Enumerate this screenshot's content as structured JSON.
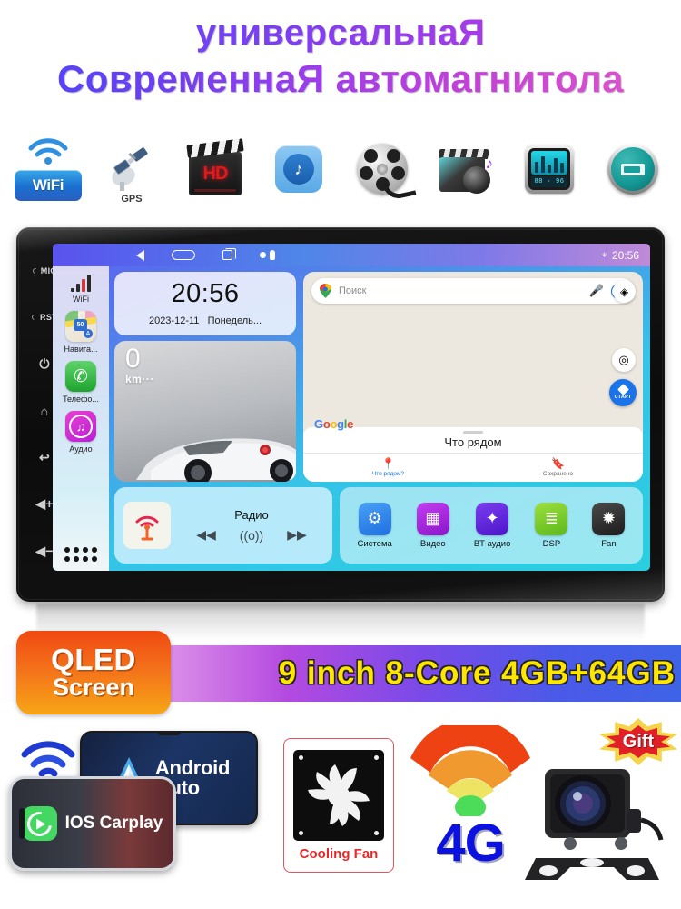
{
  "title": {
    "line1": "универсальнаЯ",
    "line2": "СовременнаЯ автомагнитола"
  },
  "feature_icons": [
    {
      "name": "wifi-icon",
      "label": "WiFi"
    },
    {
      "name": "gps-icon",
      "label": "GPS"
    },
    {
      "name": "hd-video-icon",
      "label": "HD"
    },
    {
      "name": "music-icon",
      "label": ""
    },
    {
      "name": "film-reel-icon",
      "label": ""
    },
    {
      "name": "video-audio-icon",
      "label": ""
    },
    {
      "name": "equalizer-icon",
      "label": ""
    },
    {
      "name": "usb-icon",
      "label": ""
    }
  ],
  "head_unit": {
    "bezel_buttons": [
      {
        "name": "mic-button",
        "label": "MIC"
      },
      {
        "name": "reset-button",
        "label": "RST"
      },
      {
        "name": "power-button",
        "label": "⏻"
      },
      {
        "name": "home-button",
        "label": "⌂"
      },
      {
        "name": "back-button",
        "label": "↩"
      },
      {
        "name": "volume-up-button",
        "label": "◀+"
      },
      {
        "name": "volume-down-button",
        "label": "◀−"
      }
    ],
    "statusbar": {
      "time": "20:56",
      "location_icon": "⌖"
    },
    "sidebar": [
      {
        "name": "wifi",
        "label": "WiFi"
      },
      {
        "name": "navigation",
        "label": "Навига..."
      },
      {
        "name": "phone",
        "label": "Телефо..."
      },
      {
        "name": "audio",
        "label": "Аудио"
      }
    ],
    "clock_widget": {
      "time": "20:56",
      "date": "2023-12-11",
      "weekday": "Понедель..."
    },
    "trip_widget": {
      "value": "0",
      "unit": "km···"
    },
    "maps_widget": {
      "search_placeholder": "Поиск",
      "brand": "Google",
      "start_label": "СТАРТ",
      "nearby_title": "Что рядом",
      "tabs": [
        {
          "name": "nearby",
          "label": "Что рядом?"
        },
        {
          "name": "saved",
          "label": "Сохранено"
        }
      ]
    },
    "radio_widget": {
      "title": "Радио",
      "prev": "◀◀",
      "antenna": "((o))",
      "next": "▶▶"
    },
    "apps": [
      {
        "name": "system",
        "label": "Система",
        "glyph": "⚙"
      },
      {
        "name": "video",
        "label": "Видео",
        "glyph": "▦"
      },
      {
        "name": "bt-audio",
        "label": "BT-аудио",
        "glyph": "✦"
      },
      {
        "name": "dsp",
        "label": "DSP",
        "glyph": "≣"
      },
      {
        "name": "fan",
        "label": "Fan",
        "glyph": "✹"
      }
    ]
  },
  "banner": {
    "qled_line1": "QLED",
    "qled_line2": "Screen",
    "specs": "9 inch  8-Core  4GB+64GB"
  },
  "bottom_features": {
    "android_auto_line1": "Android",
    "android_auto_line2": "Auto",
    "ios_carplay": "IOS Carplay",
    "cooling_fan": "Cooling Fan",
    "network": "4G",
    "gift": "Gift"
  }
}
